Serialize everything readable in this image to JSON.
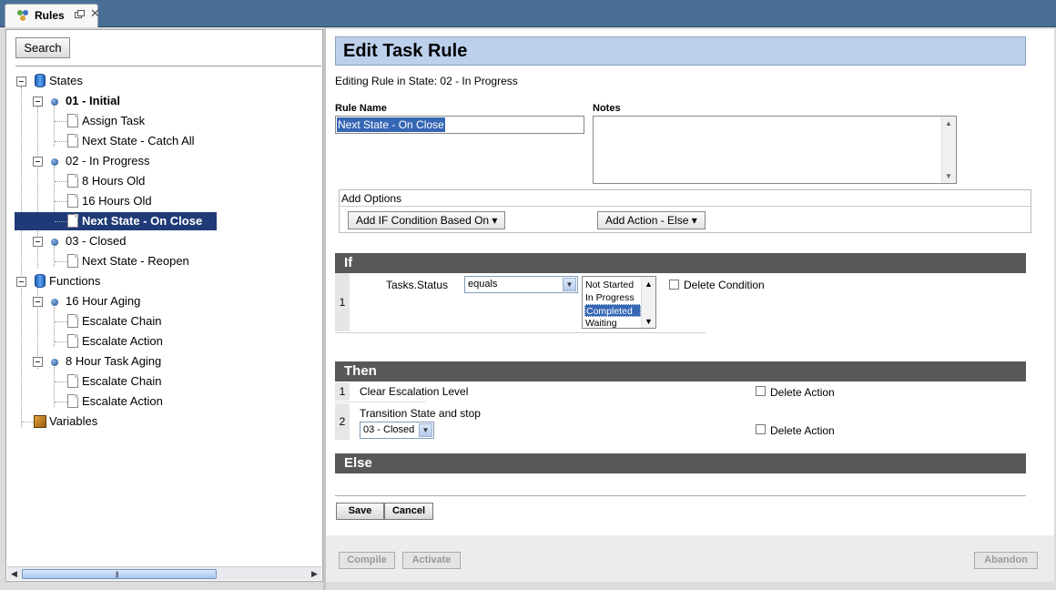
{
  "tab": {
    "label": "Rules",
    "close": "✕"
  },
  "left": {
    "search_label": "Search",
    "tree": [
      {
        "label": "States"
      },
      {
        "label": "01 - Initial"
      },
      {
        "label": "Assign Task"
      },
      {
        "label": "Next State - Catch All"
      },
      {
        "label": "02 - In Progress"
      },
      {
        "label": "8 Hours Old"
      },
      {
        "label": "16 Hours Old"
      },
      {
        "label": "Next State - On Close"
      },
      {
        "label": "03 - Closed"
      },
      {
        "label": "Next State - Reopen"
      },
      {
        "label": "Functions"
      },
      {
        "label": "16 Hour Aging"
      },
      {
        "label": "Escalate Chain"
      },
      {
        "label": "Escalate Action"
      },
      {
        "label": "8 Hour Task Aging"
      },
      {
        "label": "Escalate Chain"
      },
      {
        "label": "Escalate Action"
      },
      {
        "label": "Variables"
      }
    ],
    "scroll_left": "◀",
    "scroll_right": "▶",
    "scroll_grip": "|||"
  },
  "main": {
    "title": "Edit Task Rule",
    "subtitle": "Editing Rule in State: 02 - In Progress",
    "rule_name_label": "Rule Name",
    "rule_name_value": "Next State - On Close",
    "notes_label": "Notes",
    "add_options_label": "Add Options",
    "add_if_btn": "Add IF Condition Based On ▾",
    "add_action_btn": "Add Action - Else ▾",
    "if_title": "If",
    "condition": {
      "num": "1",
      "field": "Tasks.Status",
      "operator": "equals",
      "options": [
        "Not Started",
        "In Progress",
        "Completed",
        "Waiting"
      ],
      "selected": "Completed",
      "delete_label": "Delete Condition"
    },
    "then_title": "Then",
    "actions": [
      {
        "num": "1",
        "label": "Clear Escalation Level",
        "delete_label": "Delete Action"
      },
      {
        "num": "2",
        "label": "Transition State and stop",
        "select_value": "03 - Closed",
        "delete_label": "Delete Action"
      }
    ],
    "else_title": "Else",
    "save_label": "Save",
    "cancel_label": "Cancel",
    "compile_label": "Compile",
    "activate_label": "Activate",
    "abandon_label": "Abandon"
  }
}
